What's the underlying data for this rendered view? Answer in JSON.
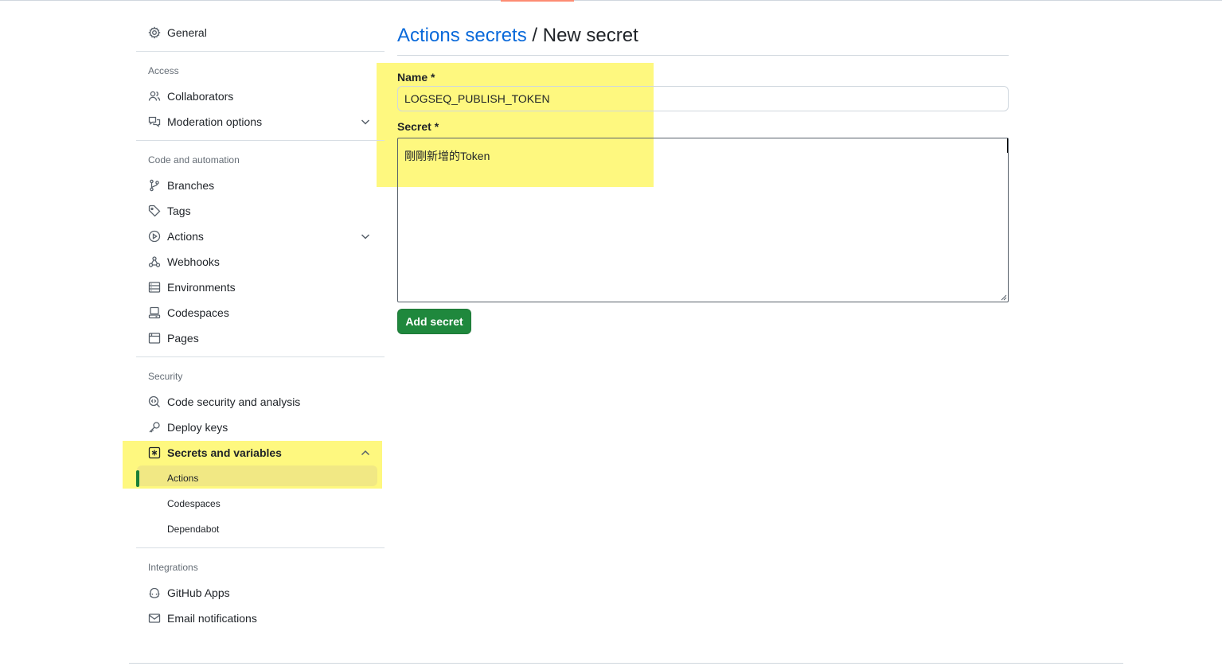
{
  "sidebar": {
    "general": "General",
    "sections": {
      "access": "Access",
      "code_automation": "Code and automation",
      "security": "Security",
      "integrations": "Integrations"
    },
    "items": {
      "collaborators": "Collaborators",
      "moderation": "Moderation options",
      "branches": "Branches",
      "tags": "Tags",
      "actions": "Actions",
      "webhooks": "Webhooks",
      "environments": "Environments",
      "codespaces": "Codespaces",
      "pages": "Pages",
      "code_security": "Code security and analysis",
      "deploy_keys": "Deploy keys",
      "secrets_variables": "Secrets and variables",
      "github_apps": "GitHub Apps",
      "email_notifications": "Email notifications"
    },
    "secrets_sub": {
      "actions": "Actions",
      "codespaces": "Codespaces",
      "dependabot": "Dependabot"
    }
  },
  "main": {
    "breadcrumb_link": "Actions secrets",
    "breadcrumb_sep": " / ",
    "breadcrumb_current": "New secret",
    "name_label": "Name *",
    "name_value": "LOGSEQ_PUBLISH_TOKEN",
    "secret_label": "Secret *",
    "secret_value": "剛剛新增的Token",
    "submit": "Add secret"
  },
  "colors": {
    "link": "#0969da",
    "primary_button": "#1f883d",
    "highlight": "#fef769",
    "active_indicator": "#1a7f37"
  }
}
